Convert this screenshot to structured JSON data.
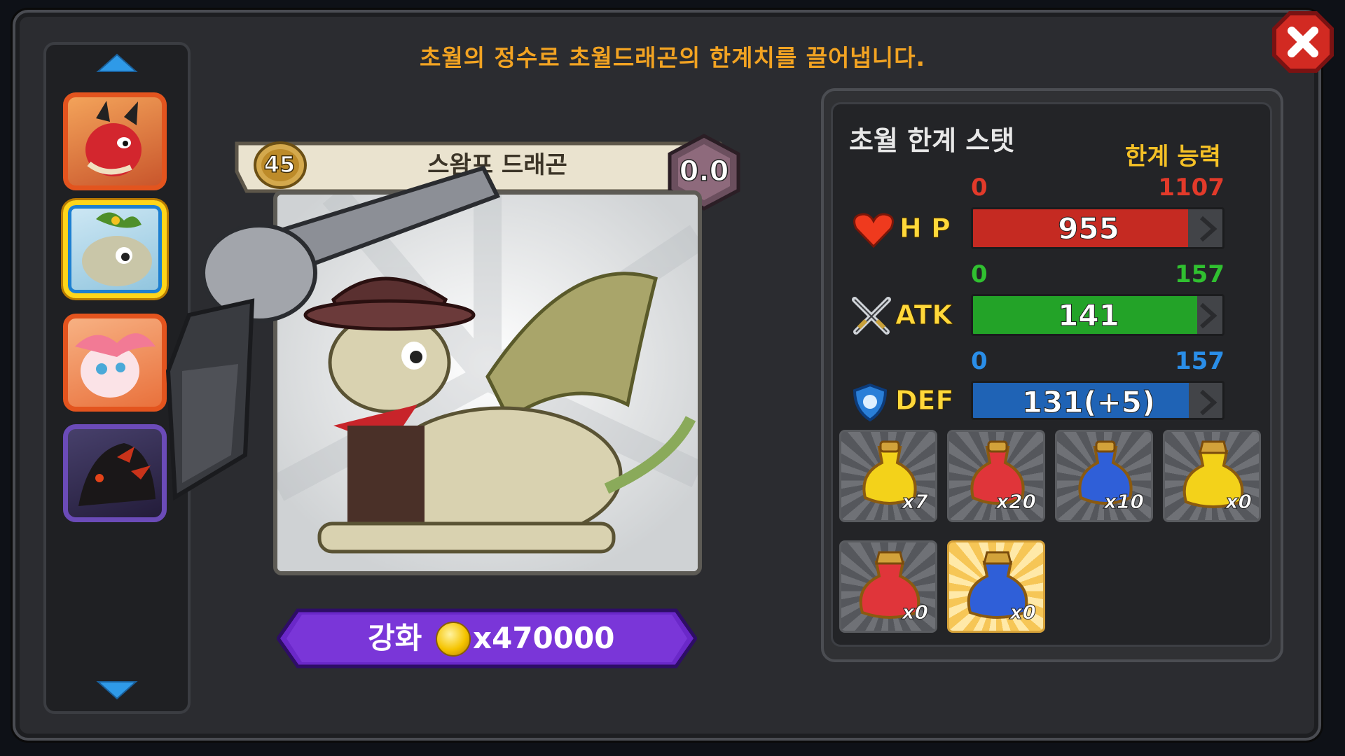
{
  "hint": "초월의 정수로 초월드래곤의 한계치를 끌어냅니다.",
  "dragon": {
    "level": "45",
    "name": "스왐프 드래곤",
    "grade": "0.0"
  },
  "upgrade": {
    "label": "강화",
    "cost": "x470000"
  },
  "stats_panel": {
    "title": "초월 한계 스탯",
    "limit_label": "한계 능력",
    "stats": [
      {
        "name": "H P",
        "min": "0",
        "max": "1107",
        "value": "955",
        "current": 955,
        "limit": 1107,
        "color": "#c52a22",
        "label_color": "#e23a2a"
      },
      {
        "name": "ATK",
        "min": "0",
        "max": "157",
        "value": "141",
        "current": 141,
        "limit": 157,
        "color": "#23a328",
        "label_color": "#30c030"
      },
      {
        "name": "DEF",
        "min": "0",
        "max": "157",
        "value": "131(+5)",
        "current": 136,
        "limit": 157,
        "color": "#1f63b5",
        "label_color": "#2a8ee8"
      }
    ]
  },
  "items": [
    {
      "count": "x7",
      "color": "#f3d21a",
      "icon": "yellow-potion-icon"
    },
    {
      "count": "x20",
      "color": "#e0353a",
      "icon": "red-potion-icon"
    },
    {
      "count": "x10",
      "color": "#2f5fd8",
      "icon": "blue-potion-icon"
    },
    {
      "count": "x0",
      "color": "#f3d21a",
      "icon": "large-yellow-potion-icon"
    },
    {
      "count": "x0",
      "color": "#e0353a",
      "icon": "large-red-potion-icon"
    },
    {
      "count": "x0",
      "color": "#2f5fd8",
      "icon": "large-blue-potion-icon"
    }
  ]
}
